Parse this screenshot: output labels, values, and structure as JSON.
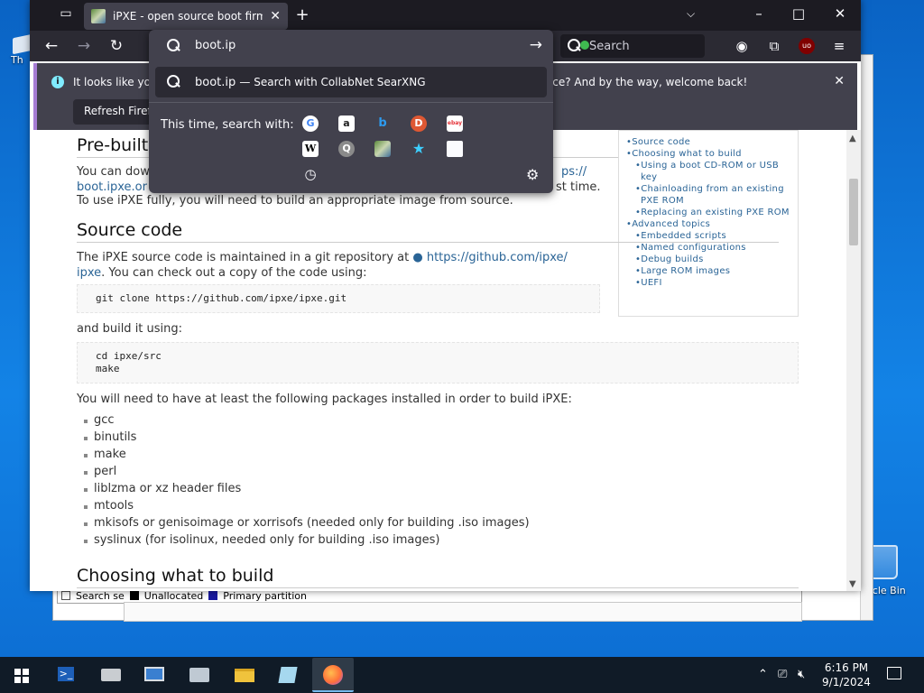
{
  "desktop": {
    "left_icon_label": "Th",
    "recycle_label": "cycle Bin"
  },
  "bg_window": {
    "legend_left": "Search se",
    "legend_unallocated": "Unallocated",
    "legend_primary": "Primary partition",
    "colors": {
      "unallocated": "#000000",
      "primary": "#1a1aa0"
    }
  },
  "browser": {
    "tab_title": "iPXE - open source boot firmware",
    "search_placeholder": "Search",
    "notification": {
      "msg_left": "It looks like you",
      "msg_right": "rience? And by the way, welcome back!",
      "refresh_label": "Refresh Firefox"
    },
    "urlbar": {
      "value": "boot.ip",
      "suggestion_text": "boot.ip",
      "suggestion_desc": "— Search with CollabNet SearXNG",
      "this_time": "This time, search with:",
      "engines": [
        {
          "name": "google-icon",
          "glyph": "G"
        },
        {
          "name": "amazon-icon",
          "glyph": "a"
        },
        {
          "name": "bing-icon",
          "glyph": "b"
        },
        {
          "name": "duckduckgo-icon",
          "glyph": "D"
        },
        {
          "name": "ebay-icon",
          "glyph": "ebay"
        },
        {
          "name": "wikipedia-icon",
          "glyph": "W"
        },
        {
          "name": "searxng-icon",
          "glyph": "Q"
        },
        {
          "name": "collabnet-icon",
          "glyph": ""
        },
        {
          "name": "bookmarks-icon",
          "glyph": "★"
        },
        {
          "name": "tabs-icon",
          "glyph": ""
        },
        {
          "name": "history-icon",
          "glyph": "◷"
        }
      ]
    },
    "accent": "#a67cd4"
  },
  "page": {
    "prebuilt_heading": "Pre-built",
    "prebuilt_p1a": "You can dow",
    "prebuilt_p1b": "ps://",
    "prebuilt_p2a": "boot.ipxe.or",
    "prebuilt_p2b": "st time.",
    "prebuilt_p3": "To use iPXE fully, you will need to build an appropriate image from source.",
    "source_heading": "Source code",
    "source_p1": "The iPXE source code is maintained in a git repository at",
    "source_link1": "https://github.com/ipxe/",
    "source_link2": "ipxe",
    "source_p2": ". You can check out a copy of the code using:",
    "code1": "git clone https://github.com/ipxe/ipxe.git",
    "build_p": "and build it using:",
    "code2": "cd ipxe/src\nmake",
    "packages_p": "You will need to have at least the following packages installed in order to build iPXE:",
    "packages": [
      "gcc",
      "binutils",
      "make",
      "perl",
      "liblzma or xz header files",
      "mtools",
      "mkisofs or genisoimage or xorrisofs (needed only for building .iso images)",
      "syslinux (for isolinux, needed only for building .iso images)"
    ],
    "choosing_heading": "Choosing what to build",
    "toc": [
      {
        "level": 1,
        "text": "Source code"
      },
      {
        "level": 1,
        "text": "Choosing what to build"
      },
      {
        "level": 2,
        "text": "Using a boot CD-ROM or USB key"
      },
      {
        "level": 2,
        "text": "Chainloading from an existing PXE ROM"
      },
      {
        "level": 2,
        "text": "Replacing an existing PXE ROM"
      },
      {
        "level": 1,
        "text": "Advanced topics"
      },
      {
        "level": 2,
        "text": "Embedded scripts"
      },
      {
        "level": 2,
        "text": "Named configurations"
      },
      {
        "level": 2,
        "text": "Debug builds"
      },
      {
        "level": 2,
        "text": "Large ROM images"
      },
      {
        "level": 2,
        "text": "UEFI"
      }
    ]
  },
  "taskbar": {
    "time": "6:16 PM",
    "date": "9/1/2024"
  }
}
